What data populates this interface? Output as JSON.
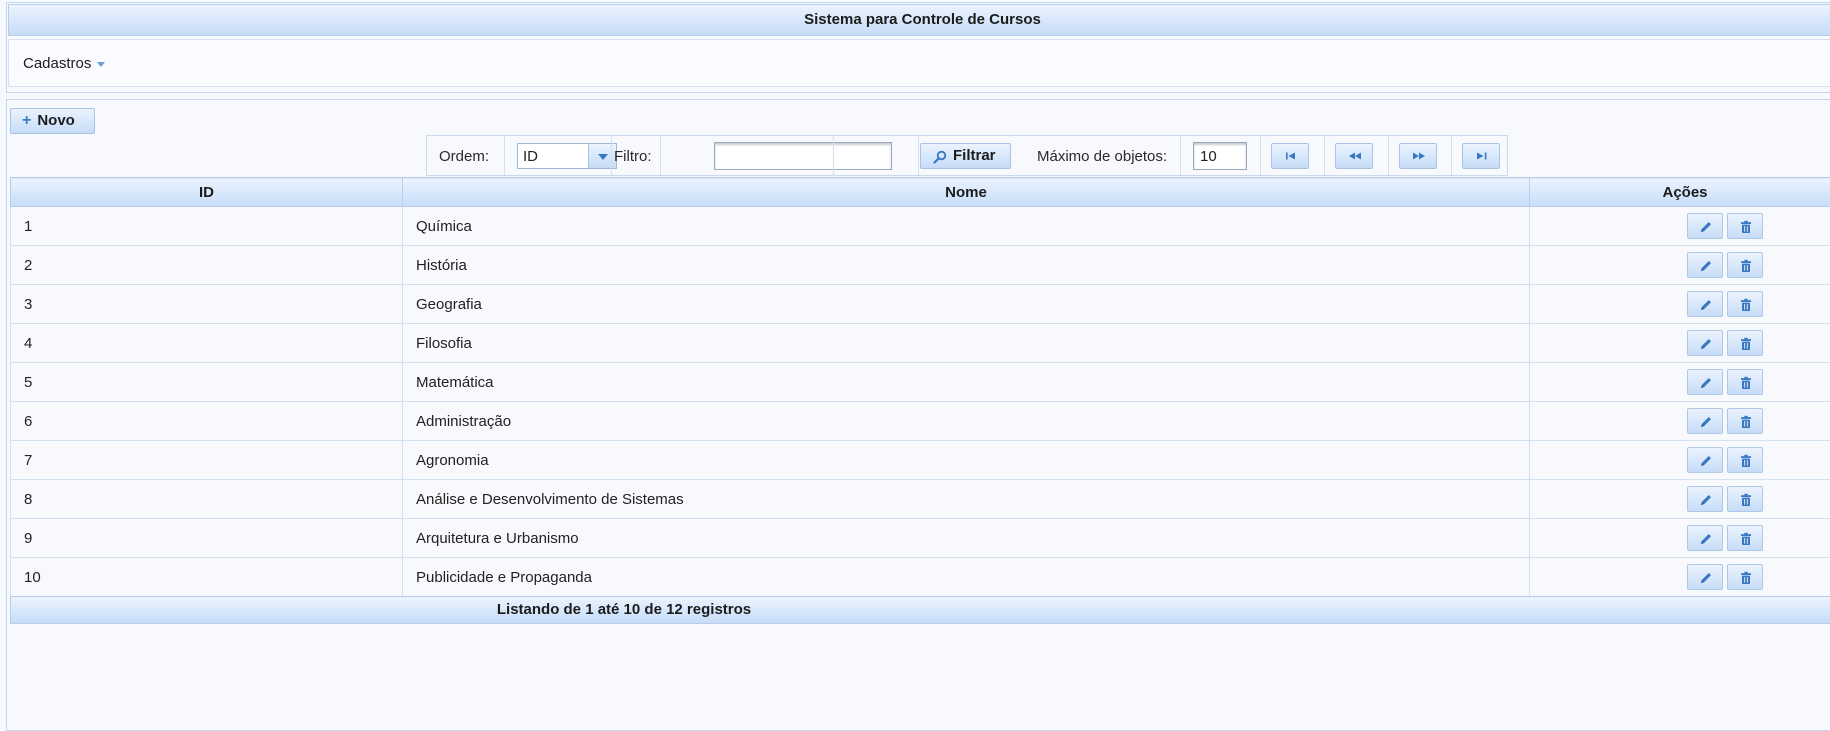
{
  "app": {
    "title": "Sistema para Controle de Cursos"
  },
  "menu": {
    "cadastros": "Cadastros"
  },
  "toolbar": {
    "novo_label": "Novo",
    "ordem_label": "Ordem:",
    "ordem_value": "ID",
    "filtro_label": "Filtro:",
    "filtro_value": "",
    "filtrar_label": "Filtrar",
    "maximo_label": "Máximo de objetos:",
    "maximo_value": "10"
  },
  "table": {
    "headers": {
      "id": "ID",
      "nome": "Nome",
      "acoes": "Ações"
    },
    "rows": [
      {
        "id": "1",
        "nome": "Química"
      },
      {
        "id": "2",
        "nome": "História"
      },
      {
        "id": "3",
        "nome": "Geografia"
      },
      {
        "id": "4",
        "nome": "Filosofia"
      },
      {
        "id": "5",
        "nome": "Matemática"
      },
      {
        "id": "6",
        "nome": "Administração"
      },
      {
        "id": "7",
        "nome": "Agronomia"
      },
      {
        "id": "8",
        "nome": "Análise e Desenvolvimento de Sistemas"
      },
      {
        "id": "9",
        "nome": "Arquitetura e Urbanismo"
      },
      {
        "id": "10",
        "nome": "Publicidade e Propaganda"
      }
    ],
    "footer": "Listando de 1 até 10 de 12 registros"
  },
  "icons": {
    "first": "seek-first-icon",
    "prev": "seek-prev-icon",
    "next": "seek-next-icon",
    "last": "seek-last-icon",
    "edit": "pencil-icon",
    "delete": "trash-icon",
    "search": "search-icon",
    "add": "plus-icon",
    "accent": "#3a78c2"
  }
}
